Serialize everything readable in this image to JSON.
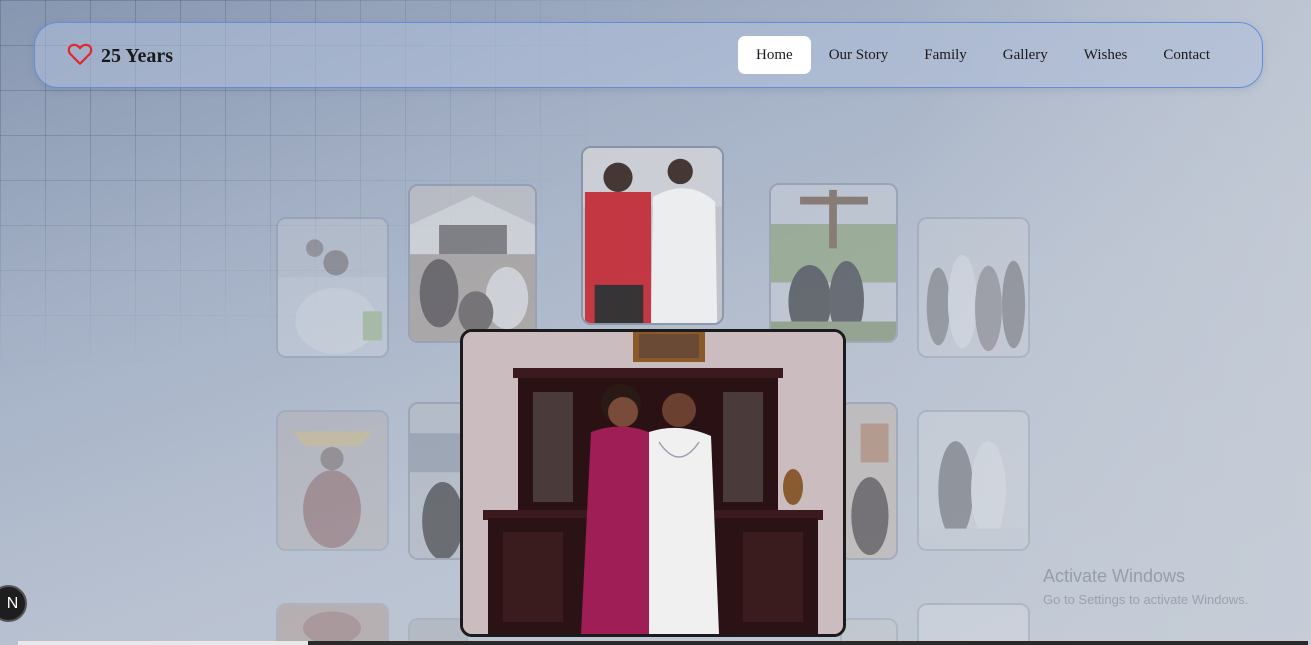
{
  "brand": {
    "title": "25 Years",
    "icon": "heart-icon",
    "icon_color": "#e0262c"
  },
  "nav": {
    "items": [
      {
        "label": "Home",
        "active": true
      },
      {
        "label": "Our Story",
        "active": false
      },
      {
        "label": "Family",
        "active": false
      },
      {
        "label": "Gallery",
        "active": false
      },
      {
        "label": "Wishes",
        "active": false
      },
      {
        "label": "Contact",
        "active": false
      }
    ],
    "border_color": "#5f8fdc"
  },
  "windows_notice": {
    "title": "Activate Windows",
    "subtitle": "Go to Settings to activate Windows."
  },
  "badge": {
    "label": "N"
  }
}
